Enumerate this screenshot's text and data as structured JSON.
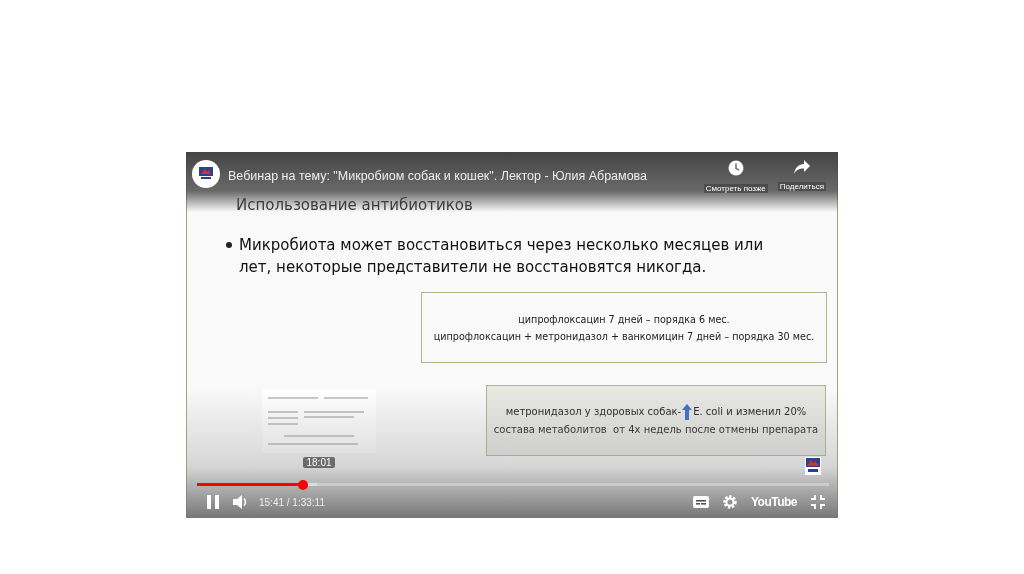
{
  "player": {
    "title": "Вебинар на тему: \"Микробиом собак и кошек\". Лектор - Юлия Абрамова",
    "watch_later": "Смотреть позже",
    "share": "Поделиться",
    "playing": true,
    "progress": {
      "level": 0.168
    },
    "buffered": {
      "level": 0.19
    },
    "preview_time": "18:01",
    "time": "15:41 / 1:33:11",
    "brand": "YouTube"
  },
  "slide": {
    "title": "Использование антибиотиков",
    "bullet": "Микробиота может восстановиться через несколько месяцев или лет, некоторые представители не восстановятся никогда.",
    "box_1": [
      "ципрофлоксацин 7 дней – порядка 6 мес.",
      "ципрофлоксацин + метронидазол + ванкомицин 7 дней – порядка 30 мес."
    ],
    "box_2": {
      "line_1_start": "метронидазол у здоровых собак-",
      "line_1_end": "E. coli и изменил 20%",
      "line_2": "состава метаболитов  от 4х недель после отмены препарата"
    }
  }
}
